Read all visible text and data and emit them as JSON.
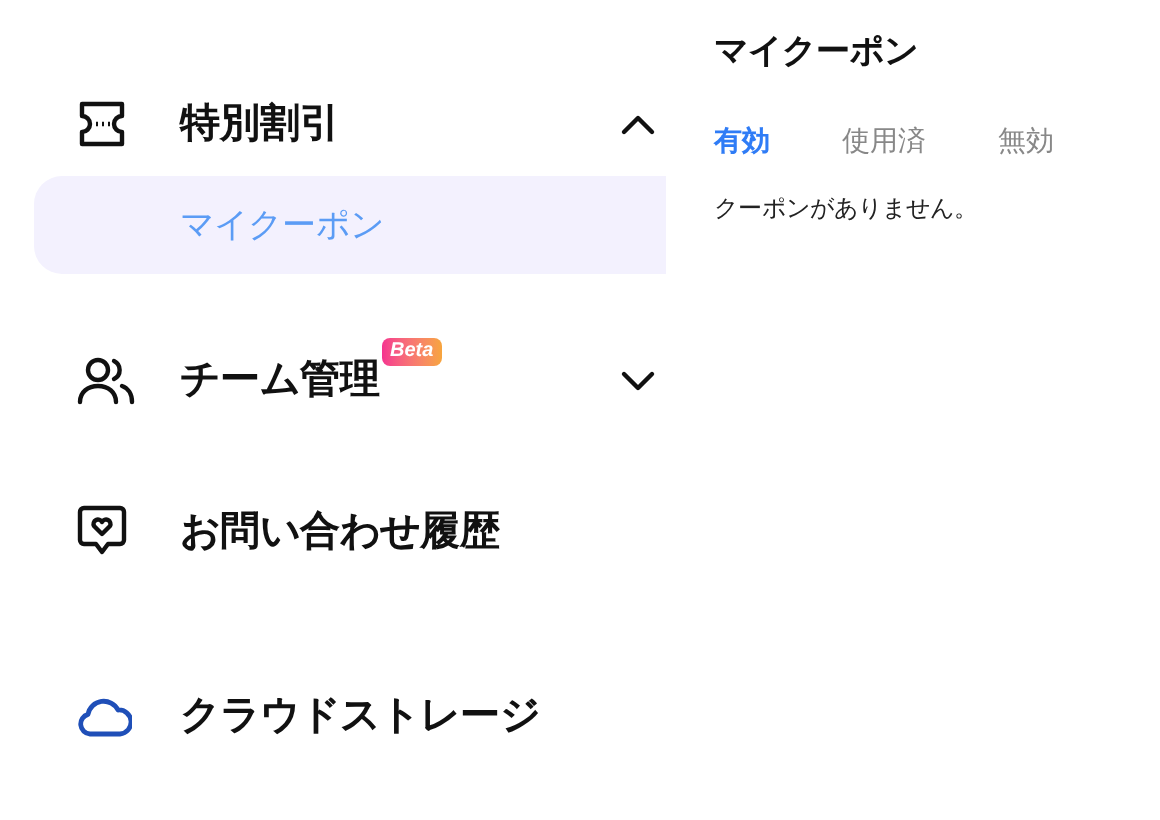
{
  "sidebar": {
    "items": [
      {
        "label": "特別割引",
        "kind": "group",
        "expanded": true,
        "children": [
          {
            "label": "マイクーポン",
            "selected": true
          }
        ]
      },
      {
        "label": "チーム管理",
        "kind": "group",
        "badge": "Beta",
        "expanded": false
      },
      {
        "label": "お問い合わせ履歴",
        "kind": "link"
      },
      {
        "label": "クラウドストレージ",
        "kind": "link"
      }
    ]
  },
  "panel": {
    "title": "マイクーポン",
    "tabs": [
      {
        "label": "有効",
        "selected": true
      },
      {
        "label": "使用済",
        "selected": false
      },
      {
        "label": "無効",
        "selected": false
      }
    ],
    "empty_message": "クーポンがありません。"
  }
}
